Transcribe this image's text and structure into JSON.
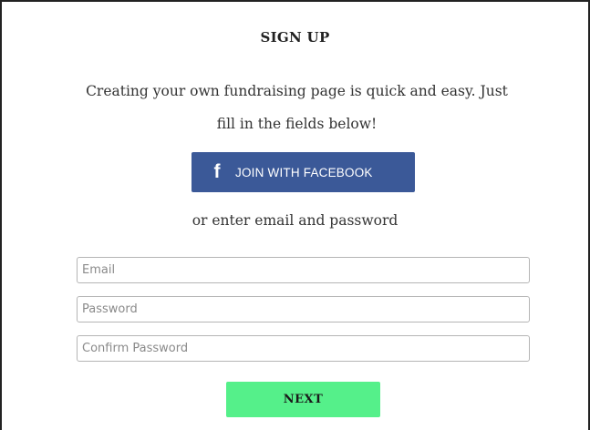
{
  "signup": {
    "title": "SIGN UP",
    "intro": "Creating your own fundraising page is quick and easy. Just fill in the fields below!",
    "facebook_icon": "f",
    "facebook_label": "JOIN WITH FACEBOOK",
    "or_text": "or enter email and password",
    "email_placeholder": "Email",
    "password_placeholder": "Password",
    "confirm_placeholder": "Confirm Password",
    "next_label": "NEXT"
  },
  "colors": {
    "facebook": "#3b5998",
    "next": "#55f08a",
    "border": "#222222"
  },
  "icons": {
    "facebook": "facebook-icon"
  }
}
